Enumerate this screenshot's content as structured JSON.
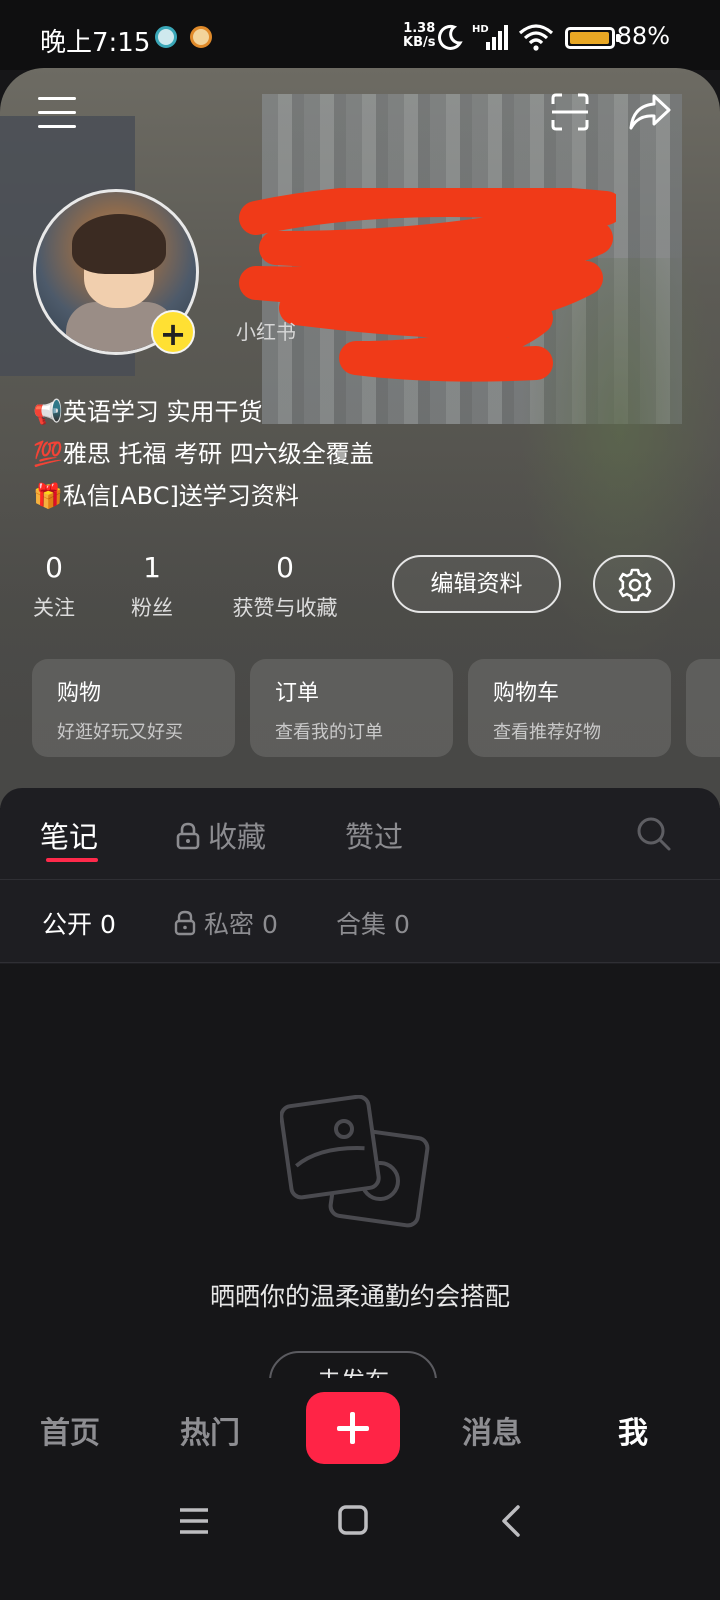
{
  "status_bar": {
    "time": "晚上7:15",
    "net_speed_value": "1.38",
    "net_speed_unit": "KB/s",
    "battery_text": "88%",
    "battery_level": 0.88,
    "battery_color": "#e8a724"
  },
  "header": {
    "menu_icon": "hamburger-icon",
    "scan_icon": "scan-icon",
    "share_icon": "share-icon",
    "avatar_add_label": "+",
    "user_sub_prefix": "小红书"
  },
  "bio": {
    "lines": [
      {
        "emoji": "📢",
        "text": "英语学习 实用干货"
      },
      {
        "emoji": "💯",
        "text": "雅思 托福 考研 四六级全覆盖"
      },
      {
        "emoji": "🎁",
        "text": "私信[ABC]送学习资料"
      }
    ]
  },
  "stats": [
    {
      "value": "0",
      "label": "关注"
    },
    {
      "value": "1",
      "label": "粉丝"
    },
    {
      "value": "0",
      "label": "获赞与收藏"
    }
  ],
  "actions": {
    "edit_label": "编辑资料",
    "settings_icon": "gear-icon"
  },
  "cards": [
    {
      "title": "购物",
      "subtitle": "好逛好玩又好买"
    },
    {
      "title": "订单",
      "subtitle": "查看我的订单"
    },
    {
      "title": "购物车",
      "subtitle": "查看推荐好物"
    }
  ],
  "tabs": {
    "items": [
      "笔记",
      "收藏",
      "赞过"
    ],
    "active_index": 0,
    "accent": "#ff2a4b"
  },
  "subtabs": [
    {
      "label": "公开 0",
      "locked": false
    },
    {
      "label": "私密 0",
      "locked": true
    },
    {
      "label": "合集 0",
      "locked": false
    }
  ],
  "empty_state": {
    "icon": "photos-icon",
    "text": "晒晒你的温柔通勤约会搭配",
    "button_label": "去发布"
  },
  "bottom_nav": {
    "items": [
      "首页",
      "热门",
      "消息",
      "我"
    ],
    "active": "我",
    "add_color": "#ff2446"
  }
}
